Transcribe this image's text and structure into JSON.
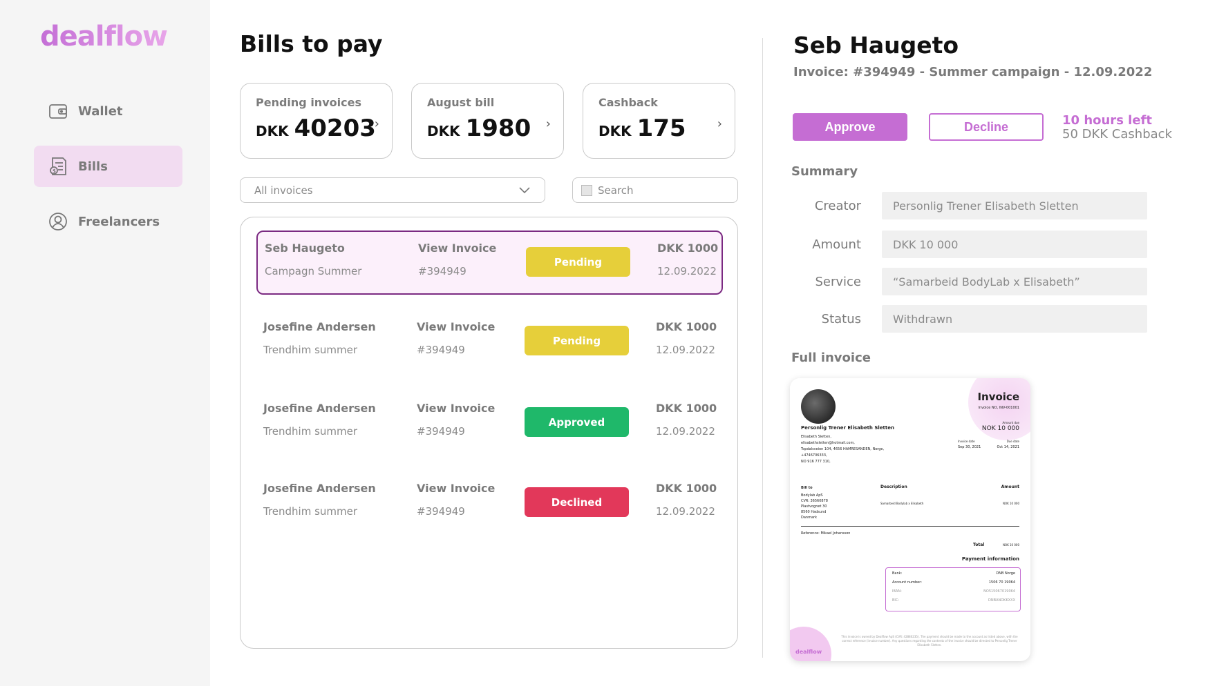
{
  "brand": {
    "logo": "dealflow"
  },
  "sidebar": {
    "items": [
      {
        "label": "Wallet",
        "icon": "wallet-icon",
        "active": false
      },
      {
        "label": "Bills",
        "icon": "bills-icon",
        "active": true
      },
      {
        "label": "Freelancers",
        "icon": "user-circle-icon",
        "active": false
      }
    ]
  },
  "main": {
    "title": "Bills to pay",
    "cards": [
      {
        "label": "Pending invoices",
        "currency": "DKK",
        "value": "40203"
      },
      {
        "label": "August bill",
        "currency": "DKK",
        "value": "1980"
      },
      {
        "label": "Cashback",
        "currency": "DKK",
        "value": "175"
      }
    ],
    "filter": {
      "selected": "All invoices"
    },
    "search": {
      "placeholder": "Search"
    },
    "rows": [
      {
        "name": "Seb Haugeto",
        "campaign": "Campagn Summer",
        "link": "View Invoice",
        "invoice": "#394949",
        "status": "Pending",
        "amount": "DKK 1000",
        "date": "12.09.2022",
        "selected": true
      },
      {
        "name": "Josefine Andersen",
        "campaign": "Trendhim summer",
        "link": "View Invoice",
        "invoice": "#394949",
        "status": "Pending",
        "amount": "DKK 1000",
        "date": "12.09.2022",
        "selected": false
      },
      {
        "name": "Josefine Andersen",
        "campaign": "Trendhim summer",
        "link": "View Invoice",
        "invoice": "#394949",
        "status": "Approved",
        "amount": "DKK 1000",
        "date": "12.09.2022",
        "selected": false
      },
      {
        "name": "Josefine Andersen",
        "campaign": "Trendhim summer",
        "link": "View Invoice",
        "invoice": "#394949",
        "status": "Declined",
        "amount": "DKK 1000",
        "date": "12.09.2022",
        "selected": false
      }
    ],
    "status_colors": {
      "Pending": "#e6cf3a",
      "Approved": "#1fb86a",
      "Declined": "#e2385a"
    }
  },
  "detail": {
    "name": "Seb Haugeto",
    "meta": "Invoice: #394949  -  Summer campaign  -  12.09.2022",
    "approve_label": "Approve",
    "decline_label": "Decline",
    "time_left": "10 hours left",
    "cashback": "50 DKK Cashback",
    "summary_title": "Summary",
    "fields": [
      {
        "label": "Creator",
        "value": "Personlig Trener Elisabeth Sletten"
      },
      {
        "label": "Amount",
        "value": "DKK 10 000"
      },
      {
        "label": "Service",
        "value": "“Samarbeid BodyLab x Elisabeth”"
      },
      {
        "label": "Status",
        "value": "Withdrawn"
      }
    ],
    "full_invoice_title": "Full invoice",
    "invoice_preview": {
      "heading": "Invoice",
      "invoice_no": "Invoice NO, INV-001001",
      "amount_due_label": "Amount due",
      "amount_due": "NOK 10 000",
      "issuer": "Personlig Trener Elisabeth Sletten",
      "issuer_lines": [
        "Elisabeth Sletten,",
        "elisabethsletten@hotmail.com,",
        "Topdalsveien 104, 4656 HAMRESANDEN, Norge,",
        "+4746706333,",
        "NO 916 777 310,"
      ],
      "invoice_date_label": "Invoice date",
      "invoice_date": "Sep 30, 2021",
      "due_date_label": "Due date",
      "due_date": "Oct 14, 2021",
      "bill_to_label": "Bill to",
      "bill_to_lines": [
        "Bodylab ApS",
        "CVR: 36560878",
        "Plastvognet 30",
        "8560 Hadsund",
        "Danmark"
      ],
      "description_label": "Description",
      "description": "Samarbeid Bodylab x Elisabeth",
      "amount_label": "Amount",
      "amount": "NOK 10 000",
      "reference": "Reference: Mikael Johansson",
      "total_label": "Total",
      "total": "NOK 10 000",
      "payment_label": "Payment information",
      "bank_label": "Bank:",
      "bank": "DNB Norge",
      "account_label": "Account number:",
      "account": "1506 70 19064",
      "iban_label": "IBAN:",
      "iban": "NO515067019064",
      "bic_label": "BIC:",
      "bic": "DNBANOKKXXX",
      "footer": "This invoice is owned by Dealflow ApS (CVR: 42880235). The payment should be made to the account as listed above, with the correct reference (invoice number). Any questions regarding the contents of the invoice should be directed to Personlig Trener Elisabeth Sletten.",
      "powered_by": "dealflow"
    }
  }
}
